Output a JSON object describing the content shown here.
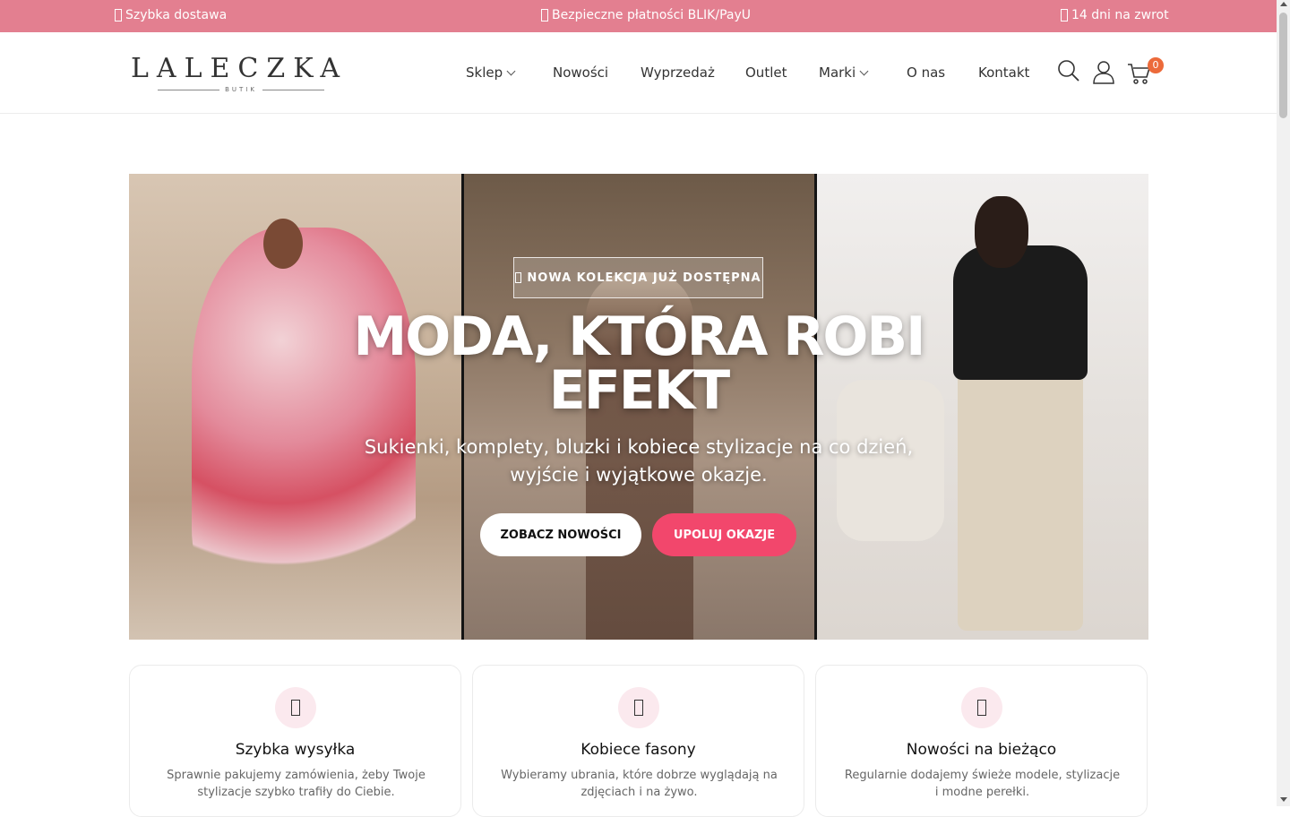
{
  "topbar": {
    "items": [
      {
        "text": "Szybka dostawa"
      },
      {
        "text": "Bezpieczne płatności BLIK/PayU"
      },
      {
        "text": "14 dni na zwrot"
      }
    ]
  },
  "header": {
    "logo_text": "LALECZKA",
    "logo_sub": "BUTIK",
    "nav": [
      {
        "label": "Sklep",
        "dropdown": true
      },
      {
        "label": "Nowości",
        "dropdown": false
      },
      {
        "label": "Wyprzedaż",
        "dropdown": false
      },
      {
        "label": "Outlet",
        "dropdown": false
      },
      {
        "label": "Marki",
        "dropdown": true
      },
      {
        "label": "O nas",
        "dropdown": false
      },
      {
        "label": "Kontakt",
        "dropdown": false
      }
    ],
    "cart_count": "0"
  },
  "hero": {
    "badge": "NOWA KOLEKCJA JUŻ DOSTĘPNA",
    "title": "MODA, KTÓRA ROBI EFEKT",
    "subtitle": "Sukienki, komplety, bluzki i kobiece stylizacje na co dzień, wyjście i wyjątkowe okazje.",
    "btn_primary": "ZOBACZ NOWOŚCI",
    "btn_secondary": "UPOLUJ OKAZJE"
  },
  "features": [
    {
      "title": "Szybka wysyłka",
      "desc": "Sprawnie pakujemy zamówienia, żeby Twoje stylizacje szybko trafiły do Ciebie."
    },
    {
      "title": "Kobiece fasony",
      "desc": "Wybieramy ubrania, które dobrze wyglądają na zdjęciach i na żywo."
    },
    {
      "title": "Nowości na bieżąco",
      "desc": "Regularnie dodajemy świeże modele, stylizacje i modne perełki."
    }
  ],
  "colors": {
    "topbar_bg": "#e37f90",
    "accent_pink": "#f2476c",
    "cart_badge": "#ec6a3a"
  }
}
